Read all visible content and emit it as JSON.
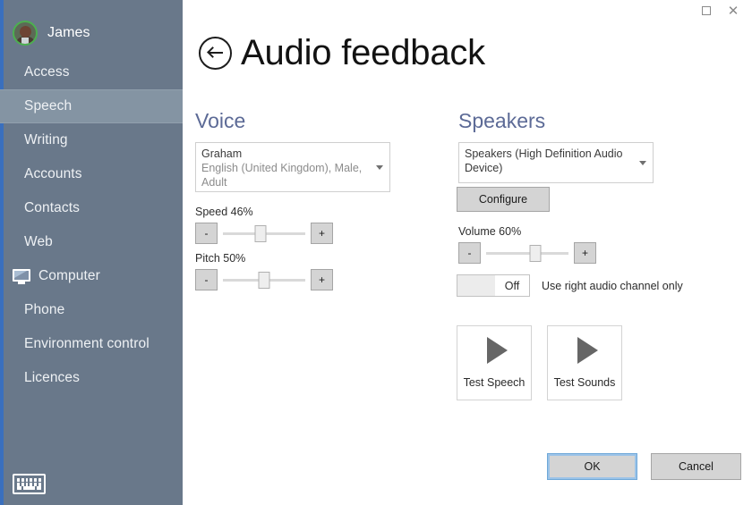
{
  "window": {
    "controls": [
      {
        "name": "restore",
        "glyph": "square"
      },
      {
        "name": "close",
        "glyph": "✕"
      }
    ]
  },
  "sidebar": {
    "user": {
      "name": "James",
      "avatar_icon": "user-photo-avatar",
      "ring_color": "#4cb050"
    },
    "background_color": "#69788a",
    "accent_color": "#3a6fbd",
    "selected_background": "#8494a3",
    "items": [
      {
        "label": "Access",
        "icon": null,
        "selected": false
      },
      {
        "label": "Speech",
        "icon": null,
        "selected": true
      },
      {
        "label": "Writing",
        "icon": null,
        "selected": false
      },
      {
        "label": "Accounts",
        "icon": null,
        "selected": false
      },
      {
        "label": "Contacts",
        "icon": null,
        "selected": false
      },
      {
        "label": "Web",
        "icon": null,
        "selected": false
      },
      {
        "label": "Computer",
        "icon": "monitor-icon",
        "selected": false
      },
      {
        "label": "Phone",
        "icon": null,
        "selected": false
      },
      {
        "label": "Environment control",
        "icon": null,
        "selected": false
      },
      {
        "label": "Licences",
        "icon": null,
        "selected": false
      }
    ],
    "keyboard_button_icon": "keyboard-icon"
  },
  "page": {
    "title": "Audio feedback",
    "back_icon": "back-arrow-icon",
    "heading_color": "#5c6a96"
  },
  "voice": {
    "heading": "Voice",
    "combo": {
      "name": "Graham",
      "description": "English (United Kingdom), Male, Adult",
      "caret_icon": "chevron-down-icon"
    },
    "speed": {
      "label": "Speed 46%",
      "value": 46,
      "minus_label": "-",
      "plus_label": "+"
    },
    "pitch": {
      "label": "Pitch 50%",
      "value": 50,
      "minus_label": "-",
      "plus_label": "+"
    }
  },
  "speakers": {
    "heading": "Speakers",
    "combo": {
      "value": "Speakers (High Definition Audio Device)",
      "caret_icon": "chevron-down-icon"
    },
    "configure_label": "Configure",
    "volume": {
      "label": "Volume 60%",
      "value": 60,
      "minus_label": "-",
      "plus_label": "+"
    },
    "right_channel_toggle": {
      "state": "Off",
      "label": "Use right audio channel only"
    },
    "test_speech": {
      "label": "Test Speech",
      "icon": "play-icon"
    },
    "test_sounds": {
      "label": "Test Sounds",
      "icon": "play-icon"
    }
  },
  "footer": {
    "ok_label": "OK",
    "cancel_label": "Cancel"
  }
}
